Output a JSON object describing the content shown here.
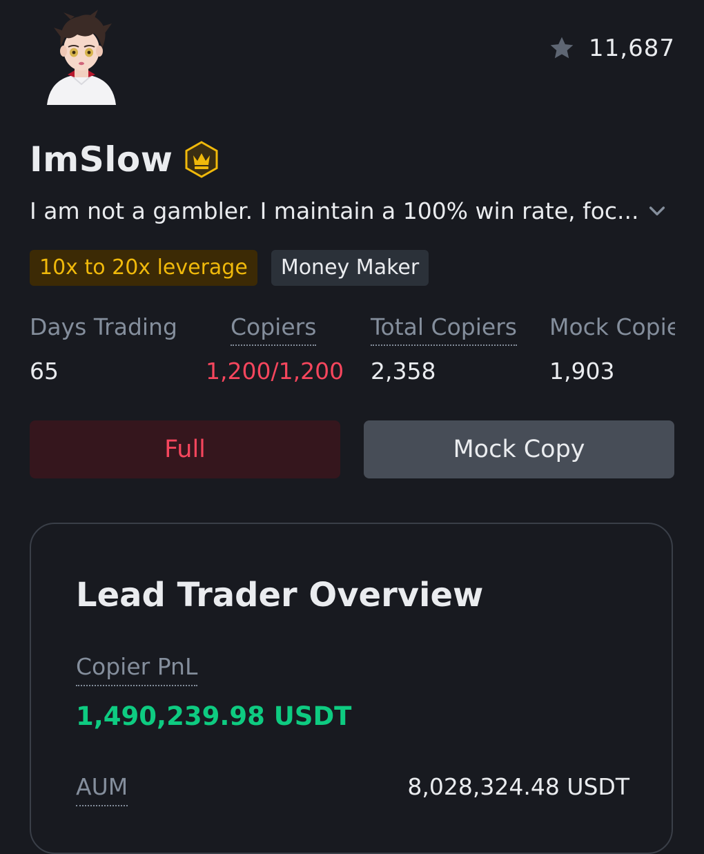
{
  "profile": {
    "name": "ImSlow",
    "bio": "I am not a gambler. I maintain a 100% win rate, foc...",
    "favorites_count": "11,687",
    "tags": [
      "10x to 20x leverage",
      "Money Maker"
    ]
  },
  "stats": [
    {
      "label": "Days Trading",
      "value": "65"
    },
    {
      "label": "Copiers",
      "value": "1,200/1,200"
    },
    {
      "label": "Total Copiers",
      "value": "2,358"
    },
    {
      "label": "Mock Copiers",
      "value": "1,903"
    }
  ],
  "buttons": {
    "full_label": "Full",
    "mock_copy_label": "Mock Copy"
  },
  "overview": {
    "title": "Lead Trader Overview",
    "copier_pnl_label": "Copier PnL",
    "copier_pnl_value": "1,490,239.98 USDT",
    "aum_label": "AUM",
    "aum_value": "8,028,324.48 USDT"
  },
  "colors": {
    "background": "#181a20",
    "accent_gold": "#f0b90b",
    "negative_red": "#f6465d",
    "positive_green": "#0ecb81",
    "muted_text": "#848e9c"
  },
  "icons": {
    "favorite": "star-icon",
    "badge": "crown-badge-icon",
    "expand": "chevron-down-icon"
  }
}
